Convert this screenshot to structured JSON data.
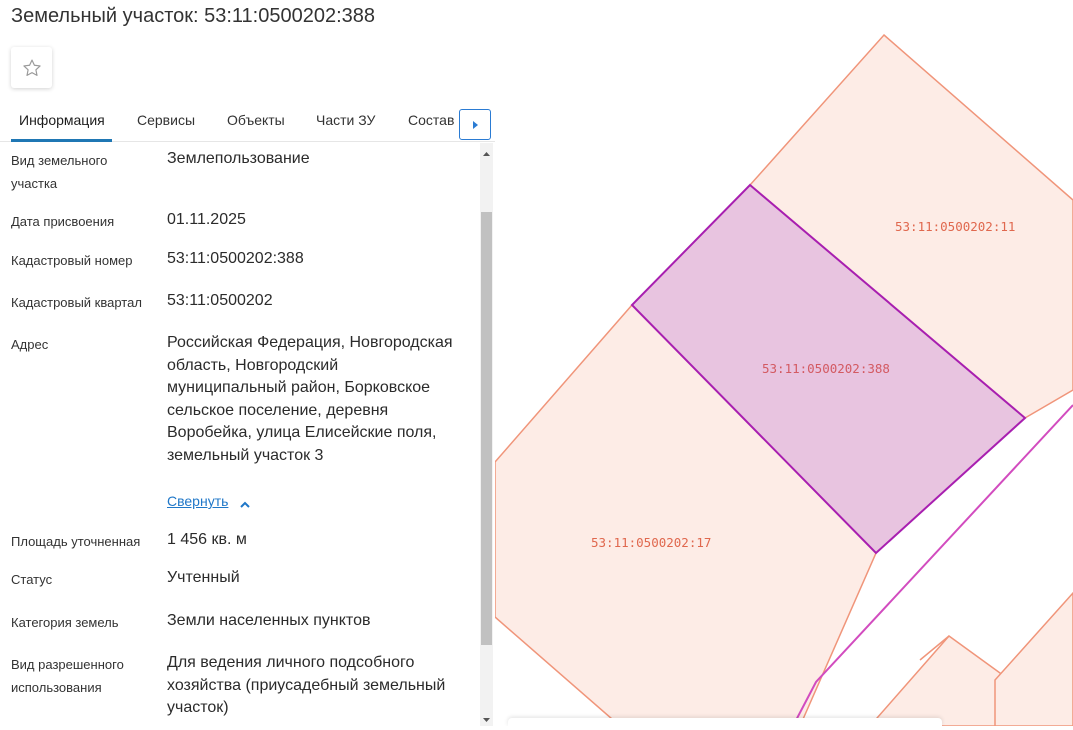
{
  "header": {
    "title": "Земельный участок: 53:11:0500202:388"
  },
  "tabs": [
    {
      "label": "Информация"
    },
    {
      "label": "Сервисы"
    },
    {
      "label": "Объекты"
    },
    {
      "label": "Части ЗУ"
    },
    {
      "label": "Состав"
    }
  ],
  "fields": {
    "land_type": {
      "label": "Вид земельного участка",
      "value": "Землепользование"
    },
    "assigned_date": {
      "label": "Дата присвоения",
      "value": "01.11.2025"
    },
    "cadastral_number": {
      "label": "Кадастровый номер",
      "value": "53:11:0500202:388"
    },
    "cadastral_quarter": {
      "label": "Кадастровый квартал",
      "value": "53:11:0500202"
    },
    "address": {
      "label": "Адрес",
      "value": "Российская Федерация, Новгородская область, Новгородский муниципальный район, Борковское сельское поселение, деревня Воробейка, улица Елисейские поля, земельный участок 3",
      "collapse_label": "Свернуть"
    },
    "area": {
      "label": "Площадь уточненная",
      "value": "1 456 кв. м"
    },
    "status": {
      "label": "Статус",
      "value": "Учтенный"
    },
    "land_category": {
      "label": "Категория земель",
      "value": "Земли населенных пунктов"
    },
    "permitted_use": {
      "label": "Вид разрешенного использования",
      "value": "Для ведения личного подсобного хозяйства (приусадебный земельный участок)"
    }
  },
  "map": {
    "parcels": [
      {
        "label": "53:11:0500202:11"
      },
      {
        "label": "53:11:0500202:388"
      },
      {
        "label": "53:11:0500202:17"
      }
    ],
    "colors": {
      "parcel_fill": "#fdece6",
      "parcel_border": "#f0957a",
      "selected_fill": "#e8c4e0",
      "selected_border": "#a81fb0",
      "label": "#e0684e",
      "selected_label": "#d35a62",
      "road_line": "#d24cbf"
    }
  },
  "icons": {
    "favorite": "star-outline-icon",
    "tabs_next": "caret-right-icon",
    "collapse": "chevron-up-icon"
  }
}
